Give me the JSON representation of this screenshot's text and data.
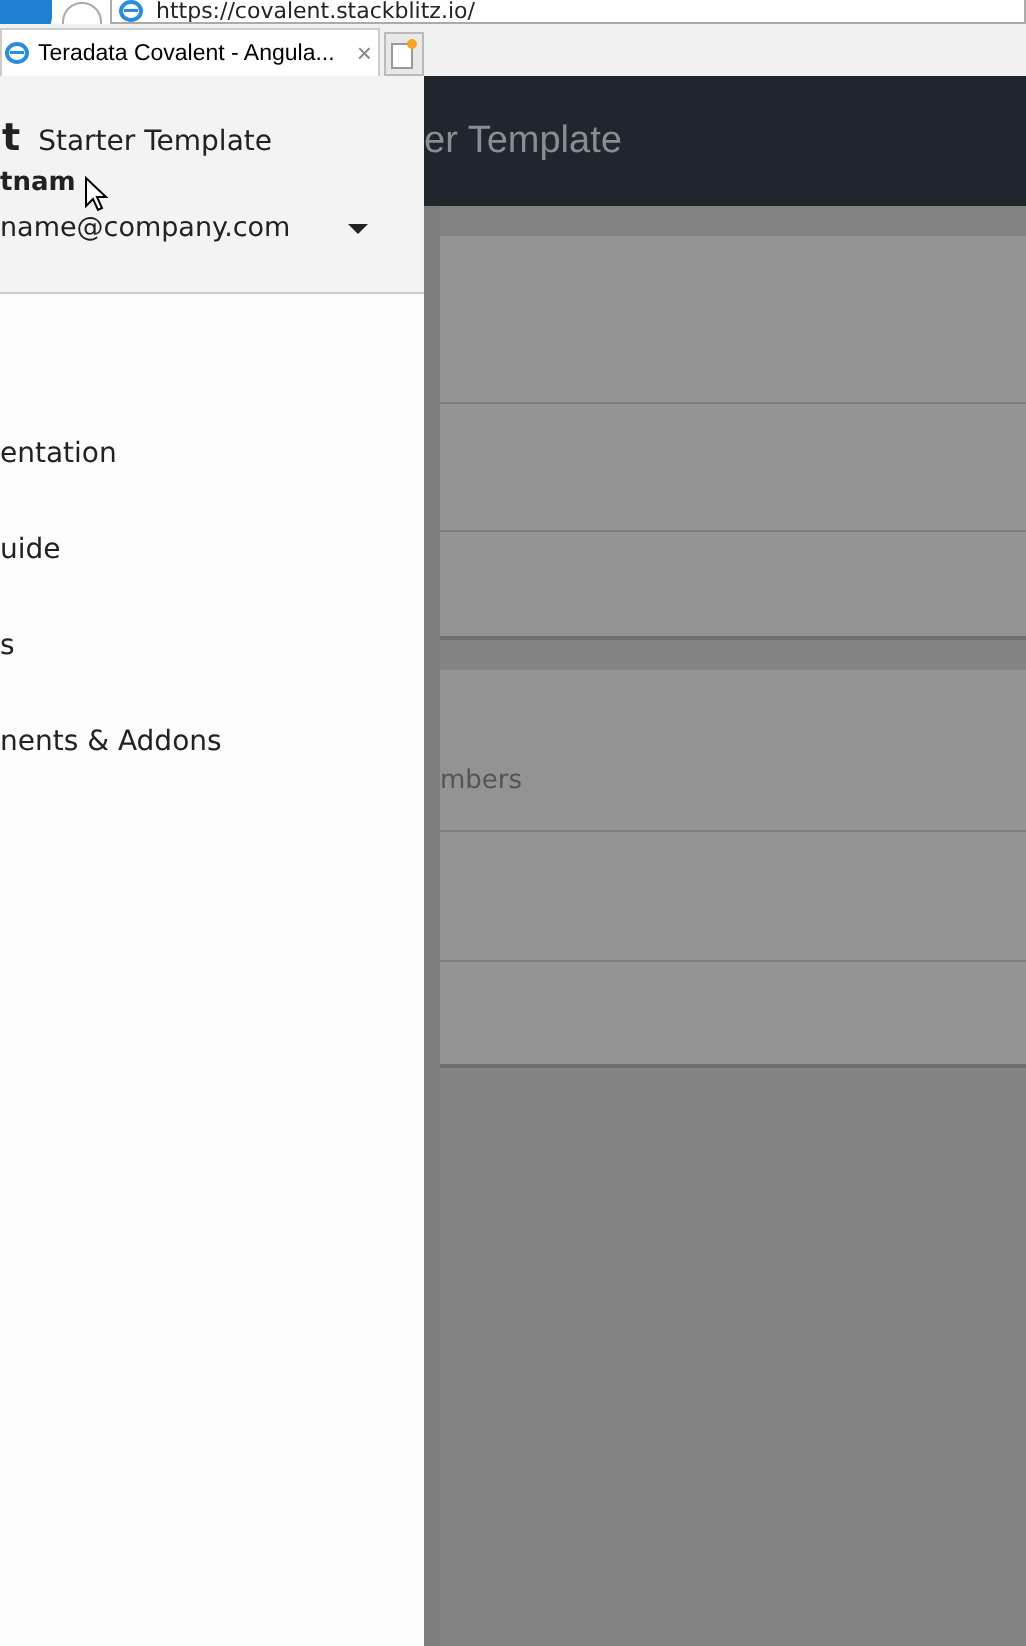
{
  "browser": {
    "address": "https://covalent.stackblitz.io/",
    "tab": {
      "title": "Teradata Covalent - Angula...",
      "close": "×"
    }
  },
  "toolbar": {
    "title": "er Template"
  },
  "drawer": {
    "brand": "t",
    "title": "Starter Template",
    "user_name": "tnam",
    "user_email": "name@company.com",
    "items": [
      {
        "label": "entation"
      },
      {
        "label": "uide"
      },
      {
        "label": "s"
      },
      {
        "label": "nents & Addons"
      }
    ]
  },
  "content_card": {
    "text": "mbers"
  }
}
